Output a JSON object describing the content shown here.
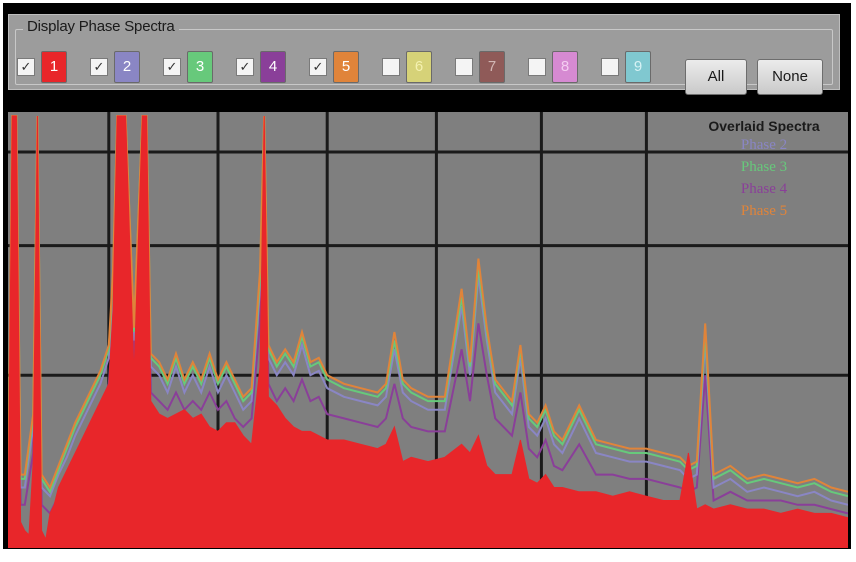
{
  "panel": {
    "title": "Display Phase Spectra",
    "phases": [
      {
        "label": "1",
        "checked": true,
        "color": "#e8262a",
        "text_color": "#ffffff"
      },
      {
        "label": "2",
        "checked": true,
        "color": "#8a86c4",
        "text_color": "#ffffff"
      },
      {
        "label": "3",
        "checked": true,
        "color": "#67c97b",
        "text_color": "#ffffff"
      },
      {
        "label": "4",
        "checked": true,
        "color": "#8a3f99",
        "text_color": "#ffffff"
      },
      {
        "label": "5",
        "checked": true,
        "color": "#e0843a",
        "text_color": "#ffffff"
      },
      {
        "label": "6",
        "checked": false,
        "color": "#d6d278",
        "text_color": "#f4f1b0"
      },
      {
        "label": "7",
        "checked": false,
        "color": "#8f5a58",
        "text_color": "#d2b6b4"
      },
      {
        "label": "8",
        "checked": false,
        "color": "#d68ad2",
        "text_color": "#f4cdf1"
      },
      {
        "label": "9",
        "checked": false,
        "color": "#80c8d0",
        "text_color": "#d6f2f4"
      }
    ],
    "all_button": "All",
    "none_button": "None"
  },
  "plot": {
    "background": "#7f7f7f",
    "grid_color": "#1a1a1a",
    "fill_color": "#e8262a",
    "overlay_title": "Overlaid Spectra",
    "overlay_entries": [
      {
        "label": "Phase 2",
        "color": "#8a86c4"
      },
      {
        "label": "Phase 3",
        "color": "#67c97b"
      },
      {
        "label": "Phase 4",
        "color": "#8a3f99"
      },
      {
        "label": "Phase 5",
        "color": "#e0843a"
      }
    ]
  },
  "chart_data": {
    "type": "area",
    "x_range": [
      0,
      100
    ],
    "y_range": [
      0,
      100
    ],
    "grid": true,
    "legend_placement": "top-right",
    "series": [
      {
        "name": "Phase 1",
        "color": "#e8262a",
        "x": [
          0,
          0.5,
          1,
          1.5,
          2,
          2.5,
          3,
          3.5,
          4,
          4.5,
          5,
          5.5,
          6,
          7,
          8,
          9,
          10,
          11,
          12,
          12.5,
          13,
          14,
          15,
          16,
          16.5,
          17,
          18,
          19,
          20,
          21,
          22,
          23,
          24,
          25,
          26,
          27,
          28,
          29,
          30,
          30.5,
          31,
          32,
          33,
          34,
          35,
          36,
          37,
          38,
          40,
          42,
          44,
          45,
          46,
          47,
          48,
          50,
          52,
          54,
          55,
          56,
          57,
          58,
          60,
          61,
          62,
          63,
          64,
          65,
          66,
          68,
          70,
          72,
          74,
          76,
          78,
          80,
          81,
          82,
          83,
          84,
          86,
          88,
          90,
          92,
          94,
          96,
          98,
          100
        ],
        "y": [
          3,
          100,
          100,
          6,
          4,
          3,
          20,
          100,
          4,
          2,
          8,
          10,
          14,
          18,
          22,
          26,
          30,
          34,
          38,
          55,
          100,
          100,
          40,
          100,
          100,
          34,
          31,
          30,
          31,
          32,
          30,
          31,
          28,
          27,
          29,
          29,
          26,
          24,
          42,
          100,
          35,
          33,
          30,
          28,
          27,
          27,
          26,
          25,
          25,
          24,
          23,
          24,
          28,
          20,
          21,
          20,
          21,
          24,
          22,
          26,
          19,
          17,
          17,
          25,
          16,
          15,
          17,
          14,
          14,
          13,
          13,
          12,
          13,
          12,
          11,
          11,
          22,
          9,
          10,
          9,
          10,
          9,
          9,
          8,
          9,
          8,
          8,
          7
        ]
      },
      {
        "name": "Phase 2",
        "color": "#8a86c4",
        "x": [
          0,
          0.5,
          1,
          1.5,
          2,
          3,
          3.5,
          4,
          5,
          6,
          7,
          8,
          9,
          10,
          11,
          12,
          12.5,
          13,
          14,
          15,
          16,
          16.5,
          17,
          18,
          19,
          20,
          21,
          22,
          23,
          24,
          25,
          26,
          27,
          28,
          29,
          30,
          30.5,
          31,
          32,
          33,
          34,
          35,
          36,
          37,
          38,
          40,
          42,
          44,
          45,
          46,
          47,
          48,
          50,
          52,
          54,
          55,
          56,
          57,
          58,
          60,
          61,
          62,
          63,
          64,
          65,
          66,
          68,
          70,
          72,
          74,
          76,
          78,
          80,
          81,
          82,
          83,
          84,
          86,
          88,
          90,
          92,
          94,
          96,
          98,
          100
        ],
        "y": [
          6,
          100,
          100,
          14,
          14,
          28,
          100,
          14,
          12,
          17,
          21,
          26,
          30,
          34,
          38,
          44,
          60,
          100,
          100,
          48,
          100,
          100,
          42,
          40,
          36,
          42,
          36,
          40,
          36,
          42,
          36,
          40,
          36,
          32,
          34,
          60,
          100,
          44,
          40,
          43,
          40,
          47,
          40,
          41,
          37,
          35,
          34,
          33,
          35,
          46,
          36,
          34,
          32,
          32,
          56,
          40,
          63,
          48,
          36,
          31,
          44,
          28,
          26,
          30,
          24,
          22,
          30,
          22,
          21,
          20,
          20,
          19,
          18,
          16,
          17,
          48,
          14,
          16,
          13,
          14,
          13,
          12,
          13,
          11,
          10
        ]
      },
      {
        "name": "Phase 3",
        "color": "#67c97b",
        "x": [
          0,
          0.5,
          1,
          1.5,
          2,
          3,
          3.5,
          4,
          5,
          6,
          7,
          8,
          9,
          10,
          11,
          12,
          12.5,
          13,
          14,
          15,
          16,
          16.5,
          17,
          18,
          19,
          20,
          21,
          22,
          23,
          24,
          25,
          26,
          27,
          28,
          29,
          30,
          30.5,
          31,
          32,
          33,
          34,
          35,
          36,
          37,
          38,
          40,
          42,
          44,
          45,
          46,
          47,
          48,
          50,
          52,
          54,
          55,
          56,
          57,
          58,
          60,
          61,
          62,
          63,
          64,
          65,
          66,
          68,
          70,
          72,
          74,
          76,
          78,
          80,
          81,
          82,
          83,
          84,
          86,
          88,
          90,
          92,
          94,
          96,
          98,
          100
        ],
        "y": [
          7,
          100,
          100,
          16,
          16,
          30,
          100,
          16,
          13,
          18,
          23,
          28,
          32,
          36,
          40,
          46,
          62,
          100,
          100,
          50,
          100,
          100,
          44,
          42,
          38,
          44,
          38,
          42,
          38,
          44,
          38,
          42,
          38,
          34,
          36,
          62,
          100,
          46,
          42,
          45,
          42,
          49,
          42,
          43,
          39,
          37,
          36,
          35,
          37,
          48,
          38,
          36,
          34,
          34,
          58,
          42,
          65,
          50,
          38,
          33,
          46,
          30,
          28,
          32,
          26,
          24,
          32,
          24,
          23,
          22,
          22,
          21,
          20,
          18,
          19,
          50,
          16,
          18,
          15,
          16,
          15,
          14,
          15,
          13,
          12
        ]
      },
      {
        "name": "Phase 4",
        "color": "#8a3f99",
        "x": [
          0,
          0.5,
          1,
          1.5,
          2,
          3,
          3.5,
          4,
          5,
          6,
          7,
          8,
          9,
          10,
          11,
          12,
          12.5,
          13,
          14,
          15,
          16,
          16.5,
          17,
          18,
          19,
          20,
          21,
          22,
          23,
          24,
          25,
          26,
          27,
          28,
          29,
          30,
          30.5,
          31,
          32,
          33,
          34,
          35,
          36,
          37,
          38,
          40,
          42,
          44,
          45,
          46,
          47,
          48,
          50,
          52,
          54,
          55,
          56,
          57,
          58,
          60,
          61,
          62,
          63,
          64,
          65,
          66,
          68,
          70,
          72,
          74,
          76,
          78,
          80,
          81,
          82,
          83,
          84,
          86,
          88,
          90,
          92,
          94,
          96,
          98,
          100
        ],
        "y": [
          4,
          100,
          100,
          10,
          10,
          22,
          100,
          10,
          8,
          12,
          16,
          20,
          24,
          28,
          32,
          38,
          52,
          100,
          100,
          42,
          100,
          100,
          36,
          34,
          32,
          36,
          32,
          34,
          32,
          36,
          32,
          34,
          30,
          28,
          30,
          52,
          100,
          38,
          34,
          37,
          34,
          39,
          34,
          35,
          31,
          30,
          29,
          28,
          30,
          38,
          30,
          28,
          27,
          27,
          46,
          34,
          52,
          40,
          30,
          26,
          36,
          23,
          21,
          25,
          19,
          18,
          24,
          17,
          17,
          16,
          16,
          15,
          14,
          13,
          14,
          40,
          11,
          13,
          11,
          11,
          11,
          10,
          10,
          9,
          8
        ]
      },
      {
        "name": "Phase 5",
        "color": "#e0843a",
        "x": [
          0,
          0.5,
          1,
          1.5,
          2,
          3,
          3.5,
          4,
          5,
          6,
          7,
          8,
          9,
          10,
          11,
          12,
          12.5,
          13,
          14,
          15,
          16,
          16.5,
          17,
          18,
          19,
          20,
          21,
          22,
          23,
          24,
          25,
          26,
          27,
          28,
          29,
          30,
          30.5,
          31,
          32,
          33,
          34,
          35,
          36,
          37,
          38,
          40,
          42,
          44,
          45,
          46,
          47,
          48,
          50,
          52,
          54,
          55,
          56,
          57,
          58,
          60,
          61,
          62,
          63,
          64,
          65,
          66,
          68,
          70,
          72,
          74,
          76,
          78,
          80,
          81,
          82,
          83,
          84,
          86,
          88,
          90,
          92,
          94,
          96,
          98,
          100
        ],
        "y": [
          8,
          100,
          100,
          17,
          17,
          31,
          100,
          17,
          14,
          19,
          24,
          29,
          33,
          37,
          41,
          47,
          64,
          100,
          100,
          51,
          100,
          100,
          45,
          43,
          39,
          45,
          39,
          43,
          39,
          45,
          39,
          43,
          39,
          35,
          37,
          64,
          100,
          47,
          43,
          46,
          43,
          50,
          43,
          44,
          40,
          38,
          37,
          36,
          38,
          50,
          39,
          37,
          35,
          35,
          60,
          43,
          67,
          51,
          39,
          34,
          47,
          31,
          29,
          33,
          27,
          25,
          33,
          25,
          24,
          23,
          23,
          22,
          21,
          19,
          20,
          52,
          17,
          19,
          16,
          17,
          16,
          15,
          16,
          14,
          13
        ]
      }
    ]
  }
}
